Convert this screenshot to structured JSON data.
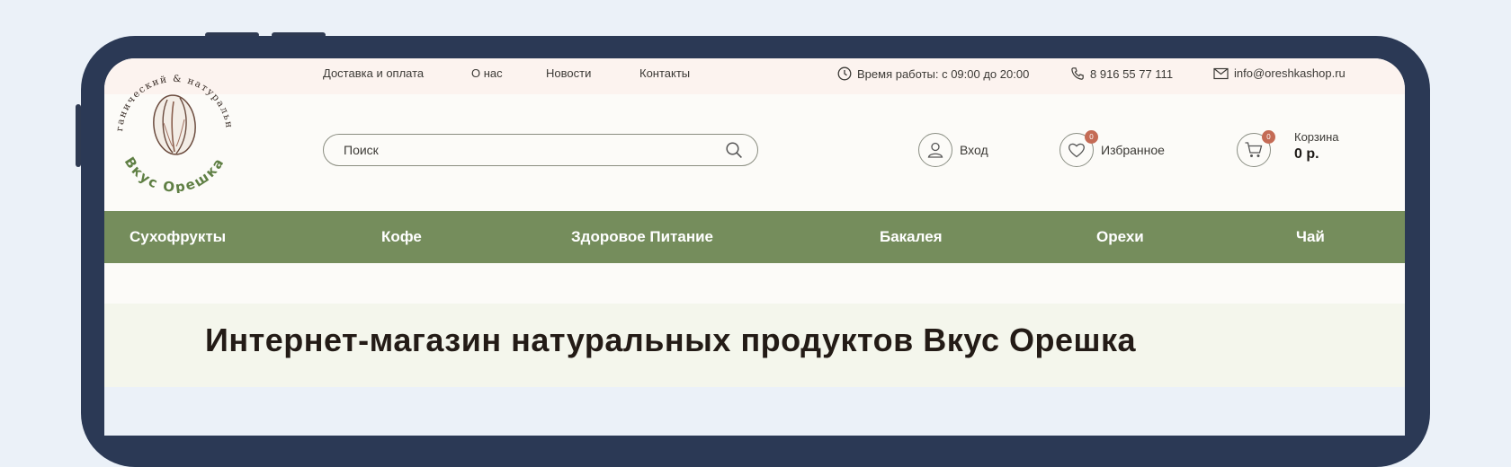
{
  "topbar": {
    "links": [
      "Доставка и оплата",
      "О нас",
      "Новости",
      "Контакты"
    ],
    "hours": "Время работы: с 09:00 до 20:00",
    "phone": "8 916 55 77 111",
    "email": "info@oreshkashop.ru"
  },
  "logo": {
    "ring_text": "органический & натуральный",
    "brand": "Вкус Орешка"
  },
  "search": {
    "placeholder": "Поиск"
  },
  "actions": {
    "login": "Вход",
    "favorites": "Избранное",
    "favorites_count": "0",
    "cart_title": "Корзина",
    "cart_count": "0",
    "cart_sum": "0 р."
  },
  "nav": {
    "items": [
      "Сухофрукты",
      "Кофе",
      "Здоровое Питание",
      "Бакалея",
      "Орехи",
      "Чай"
    ]
  },
  "hero": {
    "title": "Интернет-магазин натуральных продуктов Вкус Орешка"
  },
  "colors": {
    "frame": "#2b3955",
    "nav_bg": "#758d5c",
    "badge": "#c46b55",
    "brand_green": "#5f7f44",
    "background": "#ebf1f8"
  }
}
